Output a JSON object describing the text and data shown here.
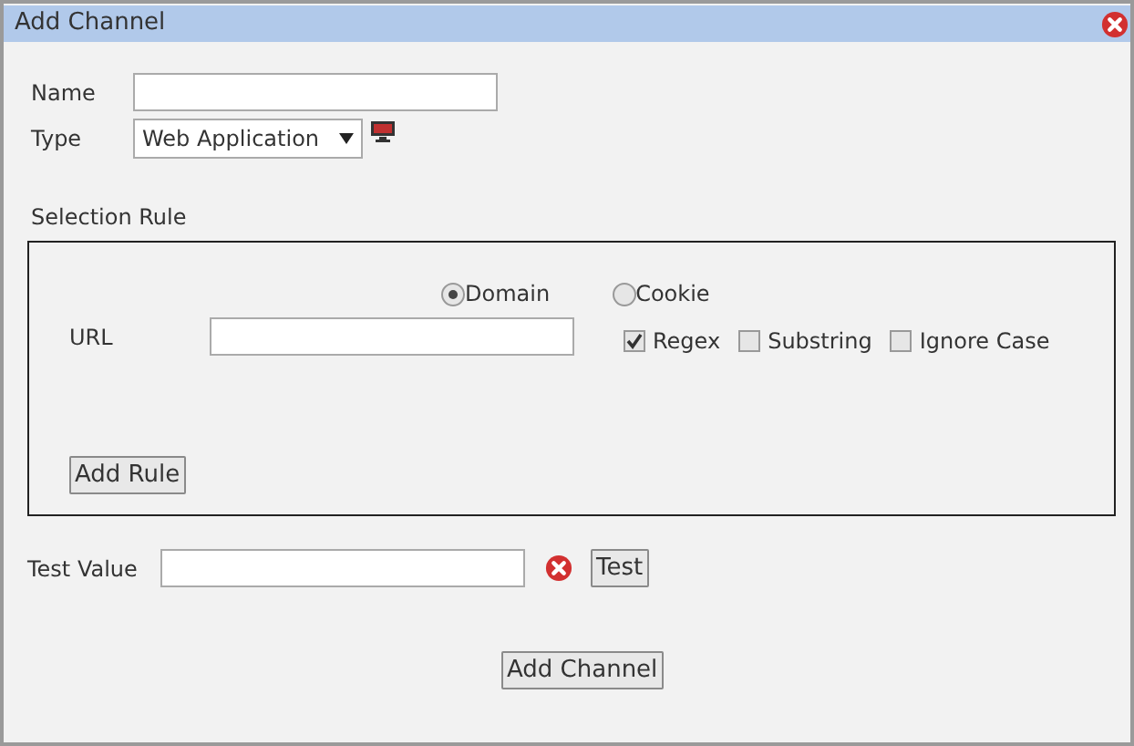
{
  "window": {
    "title": "Add Channel"
  },
  "name_field": {
    "label": "Name"
  },
  "type_field": {
    "label": "Type",
    "value": "Web Application"
  },
  "selection_rule": {
    "title": "Selection Rule",
    "radios": [
      {
        "label": "Domain",
        "selected": true
      },
      {
        "label": "Cookie",
        "selected": false
      }
    ],
    "url_label": "URL",
    "options": [
      {
        "label": "Regex",
        "checked": true
      },
      {
        "label": "Substring",
        "checked": false
      },
      {
        "label": "Ignore Case",
        "checked": false
      }
    ],
    "add_rule": "Add Rule"
  },
  "test": {
    "label": "Test Value",
    "button": "Test"
  },
  "submit": "Add Channel"
}
